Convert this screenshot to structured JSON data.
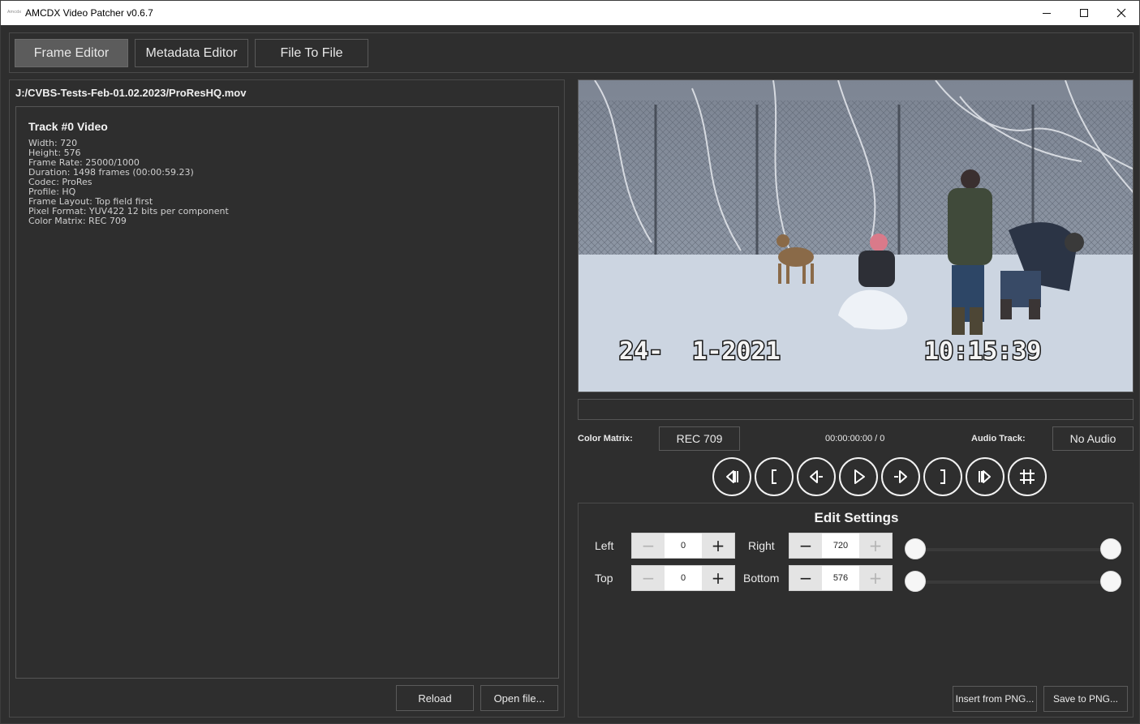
{
  "window": {
    "title": "AMCDX Video Patcher v0.6.7",
    "icon_text": "Amcdx"
  },
  "tabs": [
    {
      "label": "Frame Editor",
      "active": true
    },
    {
      "label": "Metadata Editor",
      "active": false
    },
    {
      "label": "File To File",
      "active": false
    }
  ],
  "left_panel": {
    "file_path": "J:/CVBS-Tests-Feb-01.02.2023/ProResHQ.mov",
    "track_title": "Track #0 Video",
    "track_info": [
      "Width: 720",
      "Height: 576",
      "Frame Rate: 25000/1000",
      "Duration: 1498 frames (00:00:59.23)",
      "Codec: ProRes",
      "Profile: HQ",
      "Frame Layout: Top field first",
      "Pixel Format: YUV422 12 bits per component",
      "Color Matrix: REC 709"
    ],
    "reload_label": "Reload",
    "open_label": "Open file..."
  },
  "video": {
    "overlay_date": "24-  1-2021",
    "overlay_time": "10:15:39"
  },
  "controls": {
    "color_matrix_label": "Color Matrix:",
    "color_matrix_value": "REC 709",
    "timecode": "00:00:00:00 / 0",
    "audio_track_label": "Audio Track:",
    "audio_track_value": "No Audio",
    "transport_icons": [
      "skip-to-start-icon",
      "mark-in-icon",
      "step-back-icon",
      "play-icon",
      "step-forward-icon",
      "mark-out-icon",
      "skip-to-end-icon",
      "crop-frame-icon"
    ]
  },
  "edit_settings": {
    "title": "Edit Settings",
    "left_label": "Left",
    "left_value": "0",
    "right_label": "Right",
    "right_value": "720",
    "top_label": "Top",
    "top_value": "0",
    "bottom_label": "Bottom",
    "bottom_value": "576",
    "insert_label": "Insert from PNG...",
    "save_label": "Save to PNG..."
  }
}
